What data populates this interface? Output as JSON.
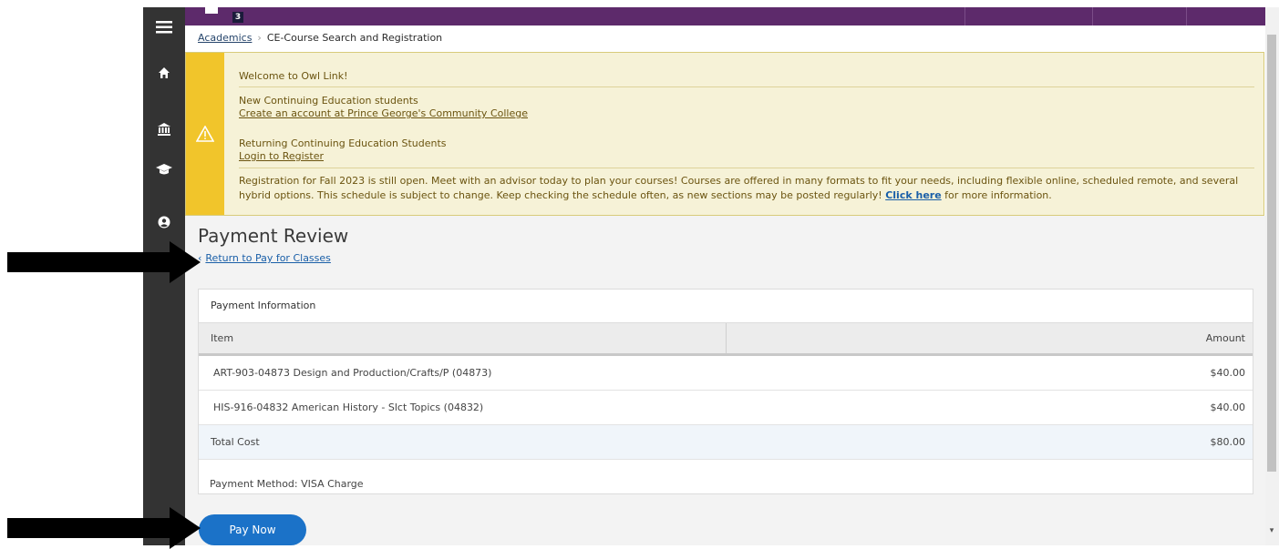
{
  "topbar": {
    "logo_number": "3"
  },
  "sidebar": {
    "icons": [
      "menu-icon",
      "home-icon",
      "bank-icon",
      "graduation-cap-icon",
      "user-circle-icon"
    ]
  },
  "breadcrumb": {
    "root": "Academics",
    "separator": "›",
    "current": "CE-Course Search and Registration"
  },
  "alert": {
    "title": "Welcome to Owl Link!",
    "new_students_heading": "New Continuing Education students",
    "new_students_link": "Create an account at Prince George's Community College",
    "returning_heading": "Returning Continuing Education Students",
    "returning_link": "Login to Register",
    "registration_text_1": "Registration for Fall 2023 is still open. Meet with an advisor today to plan your courses! Courses are offered in many formats to fit your needs, including flexible online, scheduled remote, and several",
    "registration_text_2": "hybrid options. This schedule is subject to change. Keep checking the schedule often, as new sections may be posted regularly!",
    "click_here": "Click here",
    "registration_text_3": "for more information."
  },
  "page": {
    "title": "Payment Review",
    "return_link": "Return to Pay for Classes"
  },
  "payment": {
    "panel_title": "Payment Information",
    "columns": {
      "item": "Item",
      "amount": "Amount"
    },
    "rows": [
      {
        "item": "ART-903-04873 Design and Production/Crafts/P (04873)",
        "amount": "$40.00"
      },
      {
        "item": "HIS-916-04832 American History - Slct Topics (04832)",
        "amount": "$40.00"
      }
    ],
    "total_label": "Total Cost",
    "total_amount": "$80.00",
    "method": "Payment Method: VISA Charge",
    "pay_button": "Pay Now"
  },
  "colors": {
    "sidebar": "#333333",
    "topbar": "#5d2a6b",
    "alert_bg": "#f6f2d7",
    "alert_bar": "#f1c52b",
    "button": "#1b72c8"
  }
}
